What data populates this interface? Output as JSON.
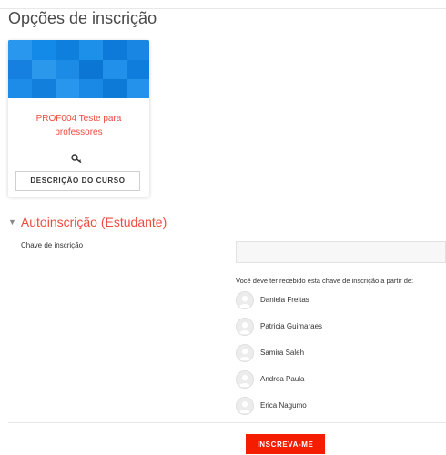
{
  "page": {
    "title": "Opções de inscrição"
  },
  "course": {
    "name": "PROF004 Teste para professores",
    "description_button": "DESCRIÇÃO DO CURSO",
    "colors": {
      "image_base": "#1a8ae6",
      "link": "#f04a3f"
    }
  },
  "self_enrolment": {
    "header": "Autoinscrição (Estudante)",
    "key_label": "Chave de inscrição",
    "key_value": "",
    "note": "Você deve ter recebido esta chave de inscrição a partir de:",
    "teachers": [
      "Daniela Freitas",
      "Patricia Guimaraes",
      "Samira Saleh",
      "Andrea Paula",
      "Erica Nagumo"
    ],
    "submit_label": "INSCREVA-ME",
    "submit_color": "#f41d00"
  },
  "icons": {
    "key": "key-icon",
    "collapse": "chevron-down-icon",
    "avatar": "user-avatar-icon"
  }
}
